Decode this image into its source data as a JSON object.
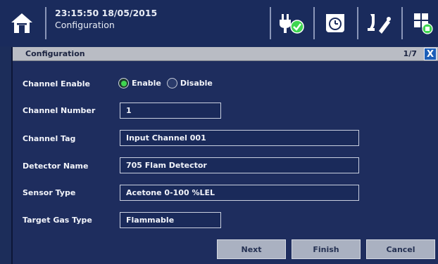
{
  "header": {
    "datetime": "23:15:50  18/05/2015",
    "subtitle": "Configuration",
    "icons": [
      "home-icon",
      "power-plug-status-icon",
      "alarm-clock-icon",
      "calibration-icon",
      "grid-settings-icon"
    ]
  },
  "window": {
    "title": "Configuration",
    "page_indicator": "1/7",
    "close_label": "X"
  },
  "form": {
    "channel_enable": {
      "label": "Channel Enable",
      "options": [
        "Enable",
        "Disable"
      ],
      "selected": "Enable"
    },
    "channel_number": {
      "label": "Channel Number",
      "value": "1"
    },
    "channel_tag": {
      "label": "Channel Tag",
      "value": "Input Channel 001"
    },
    "detector_name": {
      "label": "Detector Name",
      "value": "705 Flam Detector"
    },
    "sensor_type": {
      "label": "Sensor Type",
      "value": "Acetone 0-100 %LEL"
    },
    "target_gas_type": {
      "label": "Target Gas Type",
      "value": "Flammable"
    }
  },
  "buttons": {
    "next": "Next",
    "finish": "Finish",
    "cancel": "Cancel"
  },
  "colors": {
    "background": "#1c2d5a",
    "status_green": "#3fd650",
    "close_blue": "#1c5fb8",
    "titlebar_gray": "#b9bcc4"
  }
}
